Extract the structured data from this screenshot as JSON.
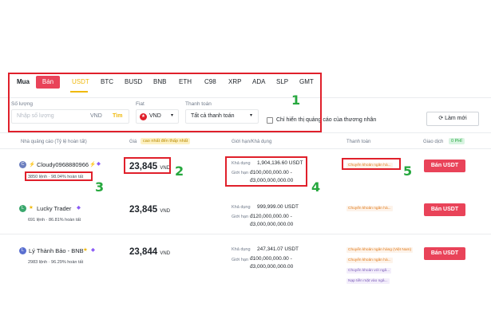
{
  "tabs": {
    "buy": "Mua",
    "sell": "Bán",
    "coins": [
      "USDT",
      "BTC",
      "BUSD",
      "BNB",
      "ETH",
      "C98",
      "XRP",
      "ADA",
      "SLP",
      "GMT"
    ]
  },
  "filters": {
    "amount_label": "Số lượng",
    "amount_placeholder": "Nhập số lượng",
    "amount_currency": "VND",
    "search_label": "Tìm",
    "fiat_label": "Fiat",
    "fiat_value": "VND",
    "payment_label": "Thanh toán",
    "payment_value": "Tất cả thanh toán",
    "checkbox_label": "Chỉ hiển thị quảng cáo của thương nhân",
    "refresh_label": "Làm mới"
  },
  "table": {
    "headers": {
      "advertiser": "Nhà quảng cáo (Tỷ lệ hoàn tất)",
      "price": "Giá",
      "price_badge": "cao nhất đến thấp nhất",
      "limit": "Giới hạn/Khả dụng",
      "payment": "Thanh toán",
      "trade": "Giao dịch",
      "trade_badge": "0 PHÍ"
    },
    "rows": [
      {
        "name": "Cloudy0968880966",
        "avatar": "C",
        "stats": "3850 lệnh · 98.04% hoàn tất",
        "price": "23,845",
        "currency": "VND",
        "available_label": "Khả dụng",
        "available": "1,904,136.60 USDT",
        "limit_label": "Giới hạn",
        "limit_min": "đ100,000,000.00 -",
        "limit_max": "đ3,000,000,000.00",
        "payments": [
          "Chuyển khoản ngân hà..."
        ],
        "button": "Bán USDT"
      },
      {
        "name": "Lucky Trader",
        "avatar": "L",
        "stats": "691 lệnh · 86.81% hoàn tất",
        "price": "23,845",
        "currency": "VND",
        "available_label": "Khả dụng",
        "available": "999,999.00 USDT",
        "limit_label": "Giới hạn",
        "limit_min": "đ120,000,000.00 -",
        "limit_max": "đ3,000,000,000.00",
        "payments": [
          "Chuyển khoản ngân hà..."
        ],
        "button": "Bán USDT"
      },
      {
        "name": "Lý Thành Bảo - BNB",
        "avatar": "L",
        "stats": "2983 lệnh · 96.29% hoàn tất",
        "price": "23,844",
        "currency": "VND",
        "available_label": "Khả dụng",
        "available": "247,341.07 USDT",
        "limit_label": "Giới hạn",
        "limit_min": "đ100,000,000.00 -",
        "limit_max": "đ3,000,000,000.00",
        "payments": [
          "Chuyển khoản ngân hàng (Việt Nam)",
          "Chuyển khoản ngân hà...",
          "Chuyển khoản với ngâ...",
          "Nạp tiền mặt vào ngâ..."
        ],
        "button": "Bán USDT"
      }
    ]
  },
  "annotations": [
    "1",
    "2",
    "3",
    "4",
    "5"
  ],
  "colors": {
    "accent": "#f0b90b",
    "sell": "#e94359",
    "annotation_box": "#e0202b",
    "annotation_number": "#26a83e"
  }
}
